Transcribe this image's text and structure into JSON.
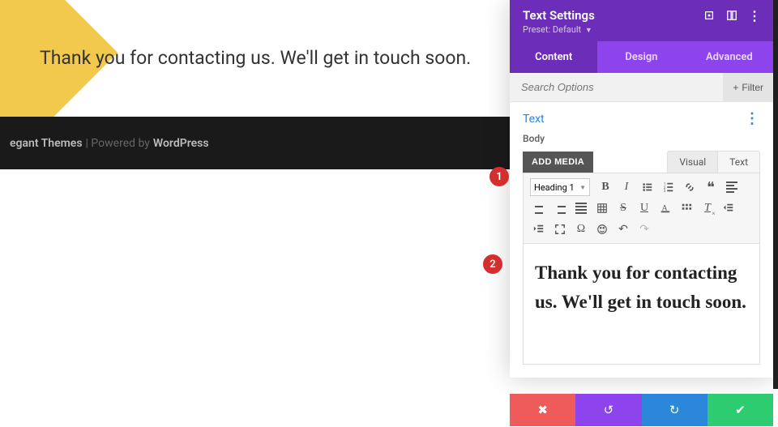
{
  "page": {
    "heading": "Thank you for contacting us. We'll get in touch soon.",
    "footer_brand": "egant Themes",
    "footer_middle": " | Powered by ",
    "footer_cms": "WordPress"
  },
  "panel": {
    "title": "Text Settings",
    "preset_label": "Preset: Default",
    "tabs": {
      "content": "Content",
      "design": "Design",
      "advanced": "Advanced"
    },
    "search_placeholder": "Search Options",
    "filter_label": "Filter",
    "section_title": "Text",
    "body_label": "Body",
    "add_media": "ADD MEDIA",
    "editor_tabs": {
      "visual": "Visual",
      "text": "Text"
    },
    "heading_select": "Heading 1",
    "editor_content": "Thank you for contacting us. We'll get in touch soon."
  },
  "markers": {
    "one": "1",
    "two": "2"
  }
}
